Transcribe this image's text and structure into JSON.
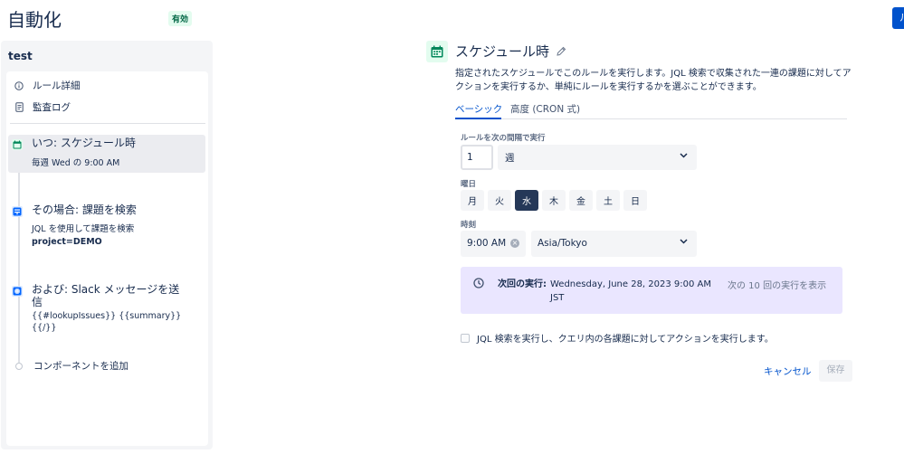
{
  "header": {
    "title": "自動化",
    "badge": "有効",
    "top_right_button": "ル"
  },
  "sidebar": {
    "rule_name": "test",
    "links": [
      {
        "icon": "info-icon",
        "label": "ルール詳細"
      },
      {
        "icon": "document-icon",
        "label": "監査ログ"
      }
    ],
    "steps": [
      {
        "icon": "calendar-icon",
        "title": "いつ: スケジュール時",
        "sub": "毎週 Wed の 9:00 AM"
      },
      {
        "icon": "jql-search-icon",
        "title": "その場合: 課題を検索",
        "sub1": "JQL を使用して課題を検索",
        "sub2": "project=DEMO"
      },
      {
        "icon": "slack-icon",
        "title_line1": "および: Slack メッセージを送",
        "title_line2": "信",
        "sub": "{{#lookupIssues}} {{summary}} {{/}}"
      }
    ],
    "add_component": "コンポーネントを追加"
  },
  "trigger": {
    "title": "スケジュール時",
    "description": "指定されたスケジュールでこのルールを実行します。JQL 検索で収集された一連の課題に対してアクションを実行するか、単純にルールを実行するかを選ぶことができます。",
    "tabs": [
      {
        "label": "ベーシック",
        "active": true
      },
      {
        "label": "高度 (CRON 式)",
        "active": false
      }
    ],
    "interval_label": "ルールを次の間隔で実行",
    "interval_value": "1",
    "interval_unit": "週",
    "days_label": "曜日",
    "days": [
      {
        "label": "月",
        "active": false
      },
      {
        "label": "火",
        "active": false
      },
      {
        "label": "水",
        "active": true
      },
      {
        "label": "木",
        "active": false
      },
      {
        "label": "金",
        "active": false
      },
      {
        "label": "土",
        "active": false
      },
      {
        "label": "日",
        "active": false
      }
    ],
    "time_label": "時刻",
    "time_value": "9:00 AM",
    "timezone": "Asia/Tokyo",
    "next_run_label": "次回の実行:",
    "next_run_value": "Wednesday, June 28, 2023 9:00 AM JST",
    "next_runs_link": "次の 10 回の実行を表示",
    "jql_checkbox_label": "JQL 検索を実行し、クエリ内の各課題に対してアクションを実行します。",
    "cancel": "キャンセル",
    "save": "保存"
  },
  "colors": {
    "accent": "#0052cc",
    "selected_day": "#253858",
    "next_run_bg": "#eae6ff",
    "trigger_icon": "#00875a"
  }
}
